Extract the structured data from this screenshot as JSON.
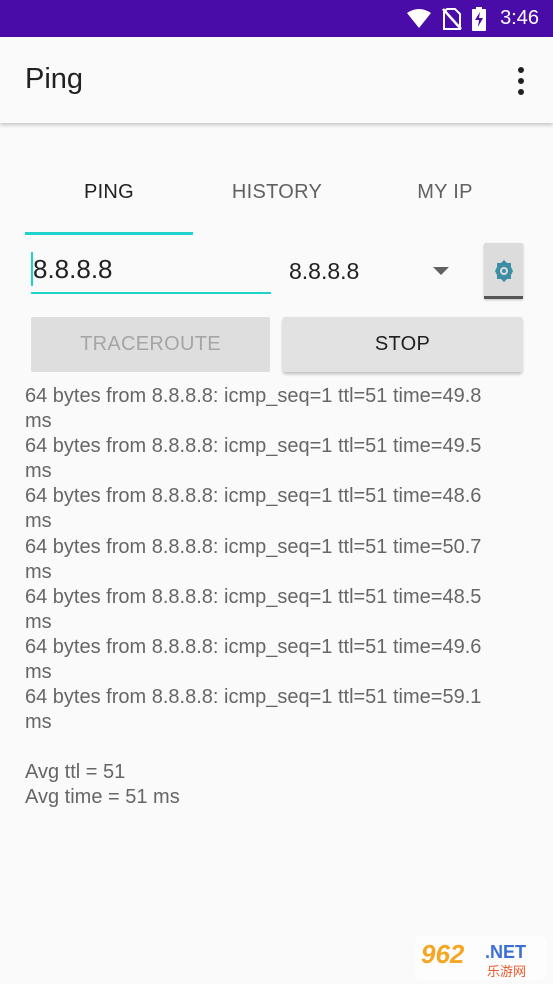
{
  "status_bar": {
    "time": "3:46",
    "background": "#4a0ca8",
    "icons": [
      "wifi-icon",
      "no-sim-icon",
      "battery-charging-icon"
    ]
  },
  "app_bar": {
    "title": "Ping",
    "overflow_icon": "more-vert-icon"
  },
  "tabs": [
    {
      "label": "PING",
      "active": true
    },
    {
      "label": "HISTORY",
      "active": false
    },
    {
      "label": "MY IP",
      "active": false
    }
  ],
  "accent_color": "#1ed3c9",
  "host_input": {
    "value": "8.8.8.8"
  },
  "host_select": {
    "selected": "8.8.8.8"
  },
  "settings_button": {
    "icon": "settings-icon"
  },
  "buttons": {
    "traceroute": "TRACEROUTE",
    "stop": "STOP"
  },
  "output": {
    "lines": [
      {
        "text": "64 bytes from 8.8.8.8: icmp_seq=1 ttl=51 time=49.8",
        "unit": "ms"
      },
      {
        "text": "64 bytes from 8.8.8.8: icmp_seq=1 ttl=51 time=49.5",
        "unit": "ms"
      },
      {
        "text": "64 bytes from 8.8.8.8: icmp_seq=1 ttl=51 time=48.6",
        "unit": "ms"
      },
      {
        "text": "64 bytes from 8.8.8.8: icmp_seq=1 ttl=51 time=50.7",
        "unit": "ms"
      },
      {
        "text": "64 bytes from 8.8.8.8: icmp_seq=1 ttl=51 time=48.5",
        "unit": "ms"
      },
      {
        "text": "64 bytes from 8.8.8.8: icmp_seq=1 ttl=51 time=49.6",
        "unit": "ms"
      },
      {
        "text": "64 bytes from 8.8.8.8: icmp_seq=1 ttl=51 time=59.1",
        "unit": "ms"
      }
    ],
    "avg_ttl": "Avg ttl = 51",
    "avg_time": "Avg time = 51 ms"
  },
  "watermark": {
    "brand": "962",
    "domain": ".NET",
    "sub": "乐游网"
  }
}
